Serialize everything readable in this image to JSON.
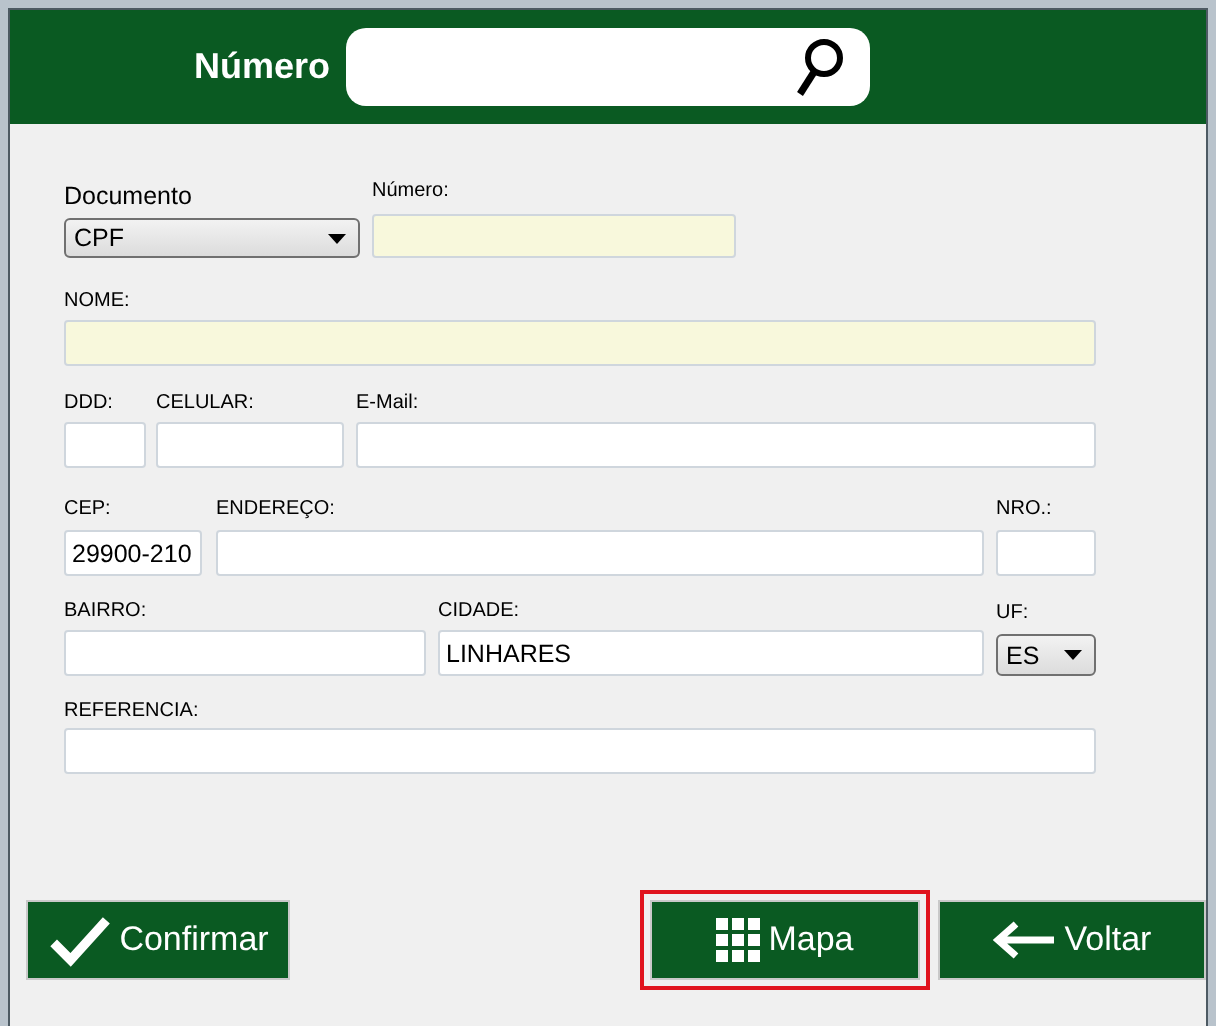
{
  "header": {
    "label": "Número"
  },
  "form": {
    "rows": [
      [
        {
          "label": "Documento",
          "kind": "select",
          "value": "CPF",
          "highlighted": false
        },
        {
          "label": "Número:",
          "kind": "input",
          "highlighted": true
        }
      ],
      [
        {
          "label": "NOME:",
          "kind": "input",
          "highlighted": true
        }
      ],
      [
        {
          "label": "DDD:",
          "kind": "input",
          "highlighted": false
        },
        {
          "label": "CELULAR:",
          "kind": "input",
          "highlighted": false
        },
        {
          "label": "E-Mail:",
          "kind": "input",
          "highlighted": false
        }
      ],
      [
        {
          "label": "CEP:",
          "kind": "input",
          "value": "29900-210",
          "highlighted": false
        },
        {
          "label": "ENDEREÇO:",
          "kind": "input",
          "highlighted": false
        },
        {
          "label": "NRO.:",
          "kind": "input",
          "highlighted": false
        }
      ],
      [
        {
          "label": "BAIRRO:",
          "kind": "input",
          "highlighted": false
        },
        {
          "label": "CIDADE:",
          "kind": "input",
          "value": "LINHARES",
          "highlighted": false
        },
        {
          "label": "UF:",
          "kind": "select",
          "value": "ES",
          "highlighted": false
        }
      ],
      [
        {
          "label": "REFERENCIA:",
          "kind": "input",
          "highlighted": false
        }
      ]
    ]
  },
  "buttons": [
    {
      "label": "Confirmar",
      "focused": false
    },
    {
      "label": "Mapa",
      "focused": true
    },
    {
      "label": "Voltar",
      "focused": false
    }
  ]
}
